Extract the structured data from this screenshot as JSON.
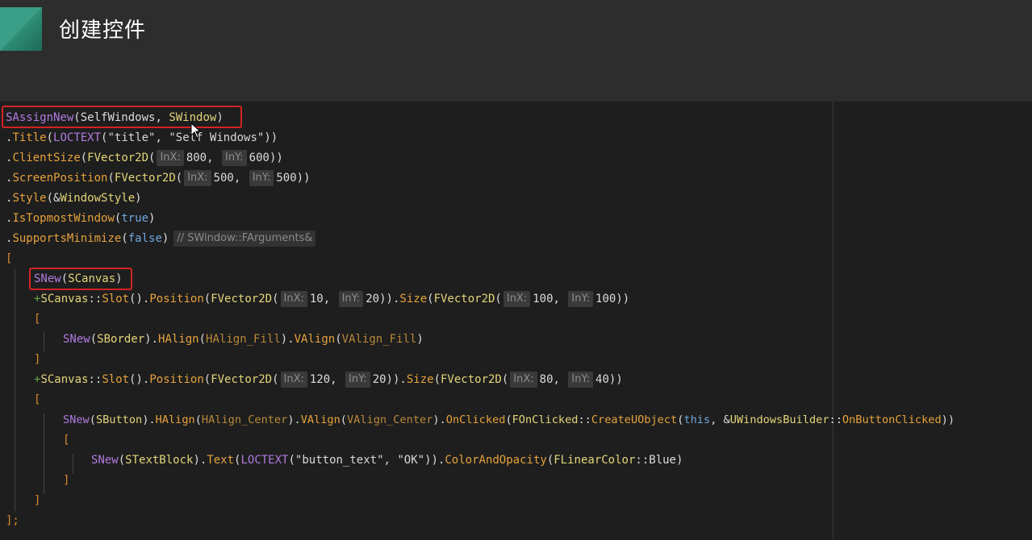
{
  "slide": {
    "title": "创建控件"
  },
  "code": {
    "lines": {
      "l1": {
        "m": "SAssignNew",
        "p1": "(SelfWindows, ",
        "t": "SWindow",
        "p2": ")"
      },
      "l2": {
        "p1": ".",
        "f": "Title",
        "p2": "(",
        "m": "LOCTEXT",
        "p3": "(",
        "s": "\"title\", \"Self Windows\"",
        "p4": "))"
      },
      "l3": {
        "p1": ".",
        "f": "ClientSize",
        "p2": "(",
        "t": "FVector2D",
        "p3": "(",
        "h1": "InX:",
        "v1": "800",
        "c": ", ",
        "h2": "InY:",
        "v2": "600",
        "p4": "))"
      },
      "l4": {
        "p1": ".",
        "f": "ScreenPosition",
        "p2": "(",
        "t": "FVector2D",
        "p3": "(",
        "h1": "InX:",
        "v1": "500",
        "c": ", ",
        "h2": "InY:",
        "v2": "500",
        "p4": "))"
      },
      "l5": {
        "p1": ".",
        "f": "Style",
        "p2": "(&",
        "t": "WindowStyle",
        "p3": ")"
      },
      "l6": {
        "p1": ".",
        "f": "IsTopmostWindow",
        "p2": "(",
        "k": "true",
        "p3": ")"
      },
      "l7": {
        "p1": ".",
        "f": "SupportsMinimize",
        "p2": "(",
        "k": "false",
        "p3": ")",
        "comment": "// SWindow::FArguments&"
      },
      "l8": {
        "b": "["
      },
      "l9": {
        "m": "SNew",
        "p1": "(",
        "t": "SCanvas",
        "p2": ")"
      },
      "l10": {
        "g": "+",
        "t1": "SCanvas",
        "p1": "::",
        "f1": "Slot",
        "p2": "().",
        "f2": "Position",
        "p3": "(",
        "t2": "FVector2D",
        "p4": "(",
        "h1": "InX:",
        "v1": "10",
        "c1": ", ",
        "h2": "InY:",
        "v2": "20",
        "p5": ")).",
        "f3": "Size",
        "p6": "(",
        "t3": "FVector2D",
        "p7": "(",
        "h3": "InX:",
        "v3": "100",
        "c2": ", ",
        "h4": "InY:",
        "v4": "100",
        "p8": "))"
      },
      "l11": {
        "b": "["
      },
      "l12": {
        "m": "SNew",
        "p1": "(",
        "t": "SBorder",
        "p2": ").",
        "f1": "HAlign",
        "p3": "(",
        "e1": "HAlign_Fill",
        "p4": ").",
        "f2": "VAlign",
        "p5": "(",
        "e2": "VAlign_Fill",
        "p6": ")"
      },
      "l13": {
        "b": "]"
      },
      "l14": {
        "g": "+",
        "t1": "SCanvas",
        "p1": "::",
        "f1": "Slot",
        "p2": "().",
        "f2": "Position",
        "p3": "(",
        "t2": "FVector2D",
        "p4": "(",
        "h1": "InX:",
        "v1": "120",
        "c1": ", ",
        "h2": "InY:",
        "v2": "20",
        "p5": ")).",
        "f3": "Size",
        "p6": "(",
        "t3": "FVector2D",
        "p7": "(",
        "h3": "InX:",
        "v3": "80",
        "c2": ", ",
        "h4": "InY:",
        "v4": "40",
        "p8": "))"
      },
      "l15": {
        "b": "["
      },
      "l16": {
        "m": "SNew",
        "p1": "(",
        "t": "SButton",
        "p2": ").",
        "f1": "HAlign",
        "p3": "(",
        "e1": "HAlign_Center",
        "p4": ").",
        "f2": "VAlign",
        "p5": "(",
        "e2": "VAlign_Center",
        "p6": ").",
        "f3": "OnClicked",
        "p7": "(",
        "t2": "FOnClicked",
        "p8": "::",
        "f4": "CreateUObject",
        "p9": "(",
        "k": "this",
        "p10": ", &",
        "t3": "UWindowsBuilder",
        "p11": "::",
        "f5": "OnButtonClicked",
        "p12": "))"
      },
      "l17": {
        "b": "["
      },
      "l18": {
        "m": "SNew",
        "p1": "(",
        "t": "STextBlock",
        "p2": ").",
        "f1": "Text",
        "p3": "(",
        "m2": "LOCTEXT",
        "p4": "(",
        "s": "\"button_text\", \"OK\"",
        "p5": ")).",
        "f2": "ColorAndOpacity",
        "p6": "(",
        "t2": "FLinearColor",
        "p7": "::",
        "e": "Blue",
        "p8": ")"
      },
      "l19": {
        "b": "]"
      },
      "l20": {
        "b": "]"
      },
      "l21": {
        "b": "];"
      }
    }
  },
  "colors": {
    "macro": "#b07be0",
    "function": "#e6a23c",
    "type": "#e3d57a",
    "keyword": "#6fa8dc",
    "highlight_box": "#d42323"
  },
  "icons": {
    "cursor": "mouse-pointer-icon",
    "logo": "teal-triangle-logo"
  }
}
